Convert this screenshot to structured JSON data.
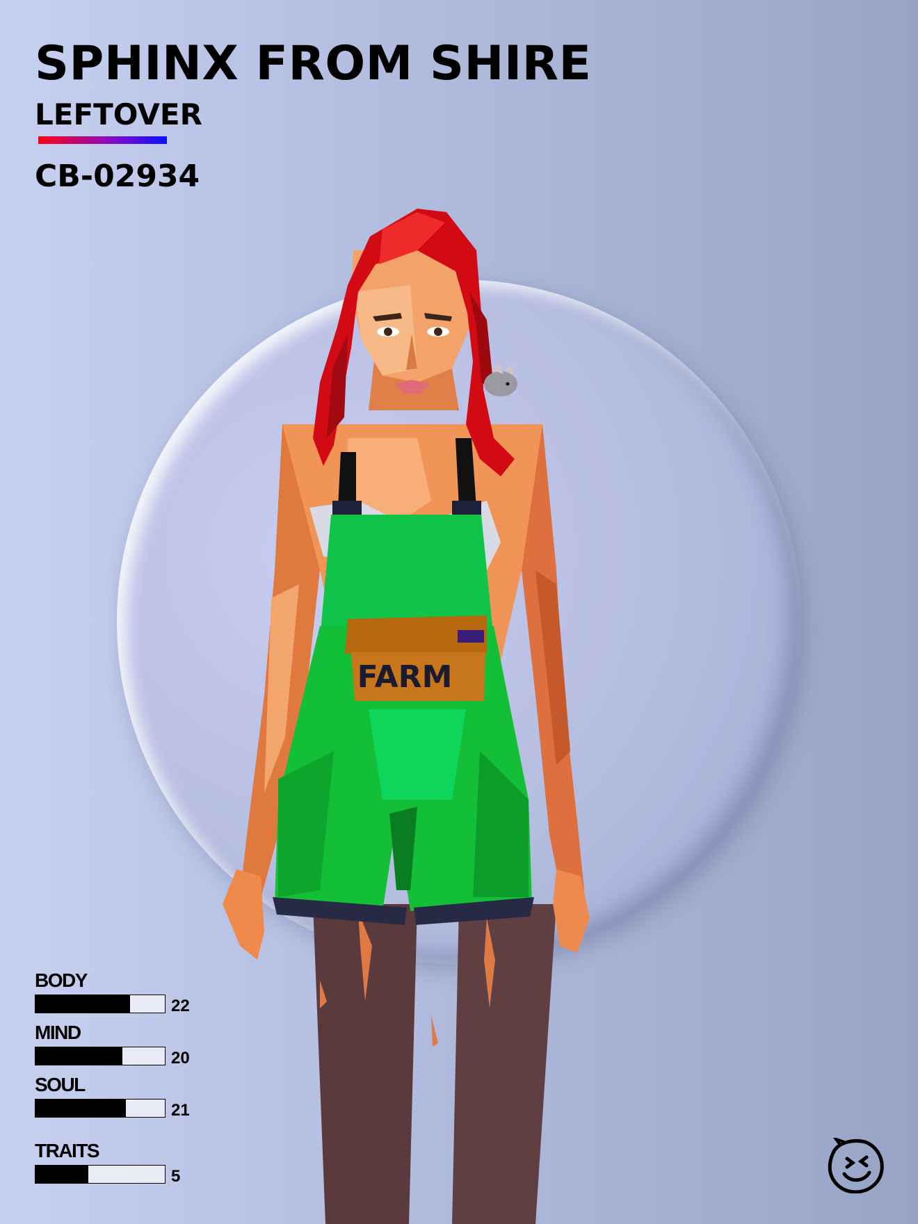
{
  "card": {
    "title": "SPHINX FROM SHIRE",
    "subtitle": "LEFTOVER",
    "code": "CB-02934",
    "accent_colors": [
      "#ff0010",
      "#8a0cc0",
      "#0b10ff"
    ]
  },
  "figure": {
    "description_icon": "character-portrait",
    "pocket_text": "FARM",
    "hair_color": "#d10a14",
    "overalls_color": "#13c43c",
    "pocket_color": "#c8761c"
  },
  "stats": [
    {
      "label": "BODY",
      "value": "22",
      "fraction": 0.73
    },
    {
      "label": "MIND",
      "value": "20",
      "fraction": 0.67
    },
    {
      "label": "SOUL",
      "value": "21",
      "fraction": 0.7
    },
    {
      "label": "TRAITS",
      "value": "5",
      "fraction": 0.41
    }
  ],
  "logo": {
    "icon": "smiley-logo-icon"
  }
}
